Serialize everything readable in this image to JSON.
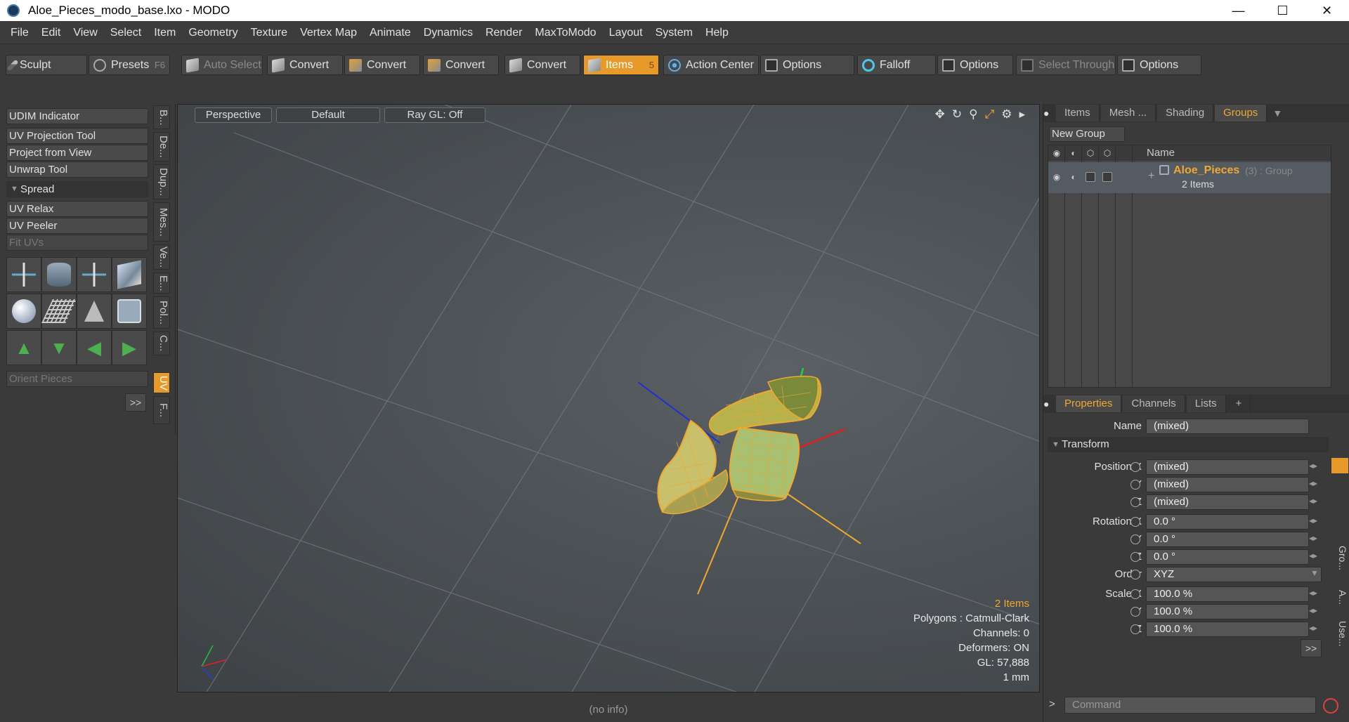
{
  "window": {
    "title": "Aloe_Pieces_modo_base.lxo - MODO",
    "minimize": "—",
    "maximize": "☐",
    "close": "✕"
  },
  "menu": [
    "File",
    "Edit",
    "View",
    "Select",
    "Item",
    "Geometry",
    "Texture",
    "Vertex Map",
    "Animate",
    "Dynamics",
    "Render",
    "MaxToModo",
    "Layout",
    "System",
    "Help"
  ],
  "toolbar": {
    "sculpt": "Sculpt",
    "presets": "Presets",
    "presets_hotkey": "F6",
    "auto_select": "Auto Select",
    "convert1": "Convert",
    "convert2": "Convert",
    "convert3": "Convert",
    "convert4": "Convert",
    "items": "Items",
    "items_hotkey": "5",
    "action_center": "Action Center",
    "options1": "Options",
    "falloff": "Falloff",
    "options2": "Options",
    "select_through": "Select Through",
    "options3": "Options"
  },
  "left_panel": {
    "udim_indicator": "UDIM Indicator",
    "uv_projection_tool": "UV Projection Tool",
    "project_from_view": "Project from View",
    "unwrap_tool": "Unwrap Tool",
    "spread": "Spread",
    "uv_relax": "UV Relax",
    "uv_peeler": "UV Peeler",
    "fit_uvs": "Fit UVs",
    "orient_pieces": "Orient Pieces",
    "more": ">>"
  },
  "vertical_tabs": [
    "B...",
    "De...",
    "Dup...",
    "Mes...",
    "Ve...",
    "E...",
    "Pol...",
    "C...",
    "UV",
    "F..."
  ],
  "viewport": {
    "view": "Perspective",
    "shading": "Default",
    "raygl": "Ray GL: Off",
    "info": {
      "items": "2 Items",
      "polygons": "Polygons : Catmull-Clark",
      "channels": "Channels: 0",
      "deformers": "Deformers: ON",
      "gl": "GL: 57,888",
      "unit": "1 mm"
    },
    "status": "(no info)"
  },
  "groups_panel": {
    "tabs": [
      "Items",
      "Mesh ...",
      "Shading",
      "Groups"
    ],
    "new_group": "New Group",
    "name_header": "Name",
    "group_name": "Aloe_Pieces",
    "group_meta": "(3) : Group",
    "group_sub": "2 Items"
  },
  "properties": {
    "tabs": [
      "Properties",
      "Channels",
      "Lists"
    ],
    "add_tab": "+",
    "name_label": "Name",
    "name_value": "(mixed)",
    "transform": "Transform",
    "position_x_label": "Position X",
    "position_x": "(mixed)",
    "position_y_label": "Y",
    "position_y": "(mixed)",
    "position_z_label": "Z",
    "position_z": "(mixed)",
    "rotation_x_label": "Rotation X",
    "rotation_x": "0.0 °",
    "rotation_y_label": "Y",
    "rotation_y": "0.0 °",
    "rotation_z_label": "Z",
    "rotation_z": "0.0 °",
    "order_label": "Order",
    "order": "XYZ",
    "scale_x_label": "Scale X",
    "scale_x": "100.0 %",
    "scale_y_label": "Y",
    "scale_y": "100.0 %",
    "scale_z_label": "Z",
    "scale_z": "100.0 %",
    "more": ">>",
    "side_tabs": [
      "Gro...",
      "A...",
      "Use..."
    ]
  },
  "command": {
    "prompt": ">",
    "placeholder": "Command"
  },
  "colors": {
    "accent": "#e79a2a",
    "mesh": "#f0a830"
  }
}
